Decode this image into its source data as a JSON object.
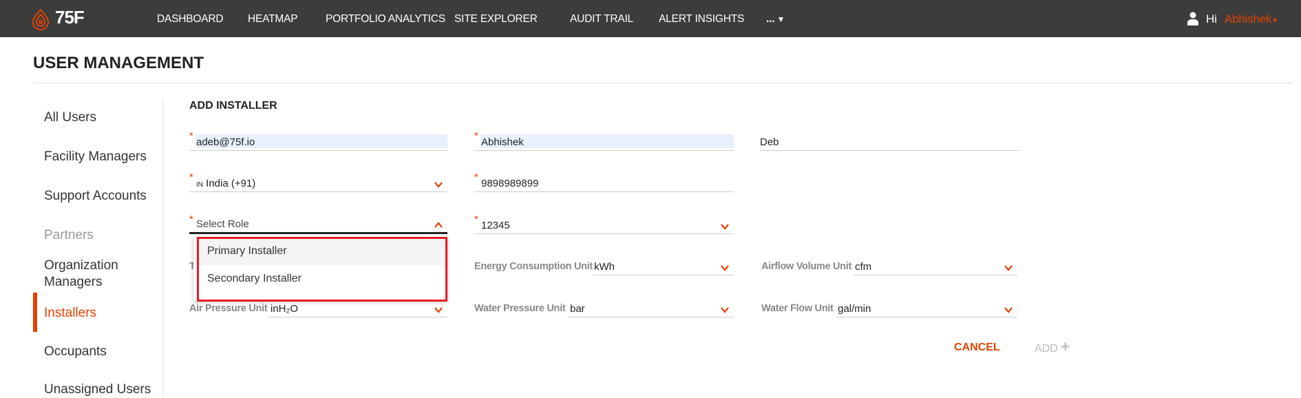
{
  "topbar": {
    "logo": "75F",
    "nav": [
      "DASHBOARD",
      "HEATMAP",
      "PORTFOLIO ANALYTICS",
      "SITE EXPLORER",
      "AUDIT TRAIL",
      "ALERT INSIGHTS",
      "..."
    ],
    "greeting": "Hi",
    "user": "Abhishek"
  },
  "page": {
    "title": "USER MANAGEMENT"
  },
  "sidebar": {
    "items": [
      {
        "label": "All Users"
      },
      {
        "label": "Facility Managers"
      },
      {
        "label": "Support Accounts"
      },
      {
        "label": "Partners"
      },
      {
        "label": "Organization Managers"
      },
      {
        "label": "Installers",
        "active": true
      },
      {
        "label": "Occupants"
      },
      {
        "label": "Unassigned Users"
      }
    ]
  },
  "form": {
    "title": "ADD INSTALLER",
    "email": "adeb@75f.io",
    "first_name": "Abhishek",
    "last_name": "Deb",
    "country_flag": "IN",
    "country": "India (+91)",
    "phone": "9898989899",
    "role_placeholder": "Select Role",
    "site": "12345",
    "role_options": [
      "Primary Installer",
      "Secondary Installer"
    ],
    "temp_label": "T",
    "energy_label": "Energy Consumption Unit",
    "energy_value": "kWh",
    "airflow_label": "Airflow Volume Unit",
    "airflow_value": "cfm",
    "air_pressure_label": "Air Pressure Unit",
    "air_pressure_value": "inH₂O",
    "water_pressure_label": "Water Pressure Unit",
    "water_pressure_value": "bar",
    "water_flow_label": "Water Flow Unit",
    "water_flow_value": "gal/min",
    "cancel": "CANCEL",
    "add": "ADD",
    "add_icon": "+"
  },
  "colors": {
    "accent": "#e24301",
    "highlight": "#e81c24",
    "topbar": "#3c3c3c"
  }
}
